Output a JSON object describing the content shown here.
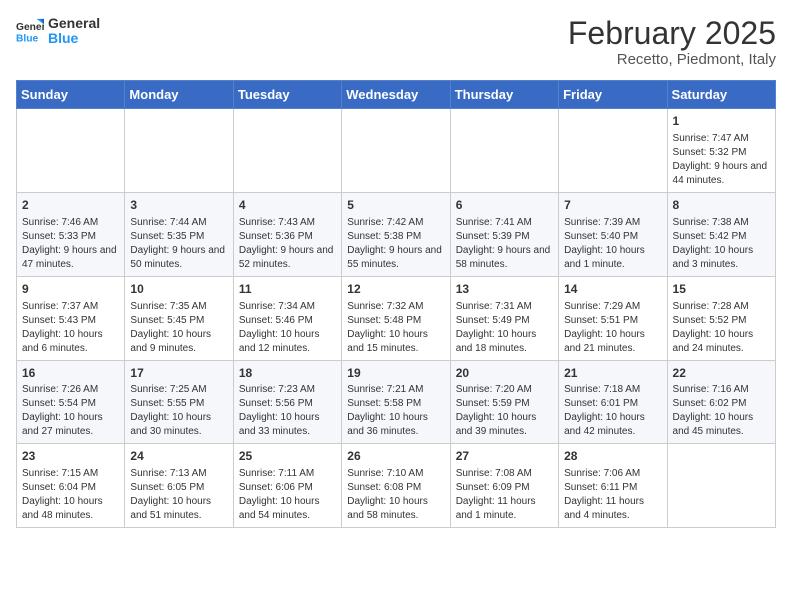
{
  "logo": {
    "line1": "General",
    "line2": "Blue"
  },
  "title": "February 2025",
  "subtitle": "Recetto, Piedmont, Italy",
  "headers": [
    "Sunday",
    "Monday",
    "Tuesday",
    "Wednesday",
    "Thursday",
    "Friday",
    "Saturday"
  ],
  "weeks": [
    [
      {
        "day": "",
        "info": ""
      },
      {
        "day": "",
        "info": ""
      },
      {
        "day": "",
        "info": ""
      },
      {
        "day": "",
        "info": ""
      },
      {
        "day": "",
        "info": ""
      },
      {
        "day": "",
        "info": ""
      },
      {
        "day": "1",
        "info": "Sunrise: 7:47 AM\nSunset: 5:32 PM\nDaylight: 9 hours and 44 minutes."
      }
    ],
    [
      {
        "day": "2",
        "info": "Sunrise: 7:46 AM\nSunset: 5:33 PM\nDaylight: 9 hours and 47 minutes."
      },
      {
        "day": "3",
        "info": "Sunrise: 7:44 AM\nSunset: 5:35 PM\nDaylight: 9 hours and 50 minutes."
      },
      {
        "day": "4",
        "info": "Sunrise: 7:43 AM\nSunset: 5:36 PM\nDaylight: 9 hours and 52 minutes."
      },
      {
        "day": "5",
        "info": "Sunrise: 7:42 AM\nSunset: 5:38 PM\nDaylight: 9 hours and 55 minutes."
      },
      {
        "day": "6",
        "info": "Sunrise: 7:41 AM\nSunset: 5:39 PM\nDaylight: 9 hours and 58 minutes."
      },
      {
        "day": "7",
        "info": "Sunrise: 7:39 AM\nSunset: 5:40 PM\nDaylight: 10 hours and 1 minute."
      },
      {
        "day": "8",
        "info": "Sunrise: 7:38 AM\nSunset: 5:42 PM\nDaylight: 10 hours and 3 minutes."
      }
    ],
    [
      {
        "day": "9",
        "info": "Sunrise: 7:37 AM\nSunset: 5:43 PM\nDaylight: 10 hours and 6 minutes."
      },
      {
        "day": "10",
        "info": "Sunrise: 7:35 AM\nSunset: 5:45 PM\nDaylight: 10 hours and 9 minutes."
      },
      {
        "day": "11",
        "info": "Sunrise: 7:34 AM\nSunset: 5:46 PM\nDaylight: 10 hours and 12 minutes."
      },
      {
        "day": "12",
        "info": "Sunrise: 7:32 AM\nSunset: 5:48 PM\nDaylight: 10 hours and 15 minutes."
      },
      {
        "day": "13",
        "info": "Sunrise: 7:31 AM\nSunset: 5:49 PM\nDaylight: 10 hours and 18 minutes."
      },
      {
        "day": "14",
        "info": "Sunrise: 7:29 AM\nSunset: 5:51 PM\nDaylight: 10 hours and 21 minutes."
      },
      {
        "day": "15",
        "info": "Sunrise: 7:28 AM\nSunset: 5:52 PM\nDaylight: 10 hours and 24 minutes."
      }
    ],
    [
      {
        "day": "16",
        "info": "Sunrise: 7:26 AM\nSunset: 5:54 PM\nDaylight: 10 hours and 27 minutes."
      },
      {
        "day": "17",
        "info": "Sunrise: 7:25 AM\nSunset: 5:55 PM\nDaylight: 10 hours and 30 minutes."
      },
      {
        "day": "18",
        "info": "Sunrise: 7:23 AM\nSunset: 5:56 PM\nDaylight: 10 hours and 33 minutes."
      },
      {
        "day": "19",
        "info": "Sunrise: 7:21 AM\nSunset: 5:58 PM\nDaylight: 10 hours and 36 minutes."
      },
      {
        "day": "20",
        "info": "Sunrise: 7:20 AM\nSunset: 5:59 PM\nDaylight: 10 hours and 39 minutes."
      },
      {
        "day": "21",
        "info": "Sunrise: 7:18 AM\nSunset: 6:01 PM\nDaylight: 10 hours and 42 minutes."
      },
      {
        "day": "22",
        "info": "Sunrise: 7:16 AM\nSunset: 6:02 PM\nDaylight: 10 hours and 45 minutes."
      }
    ],
    [
      {
        "day": "23",
        "info": "Sunrise: 7:15 AM\nSunset: 6:04 PM\nDaylight: 10 hours and 48 minutes."
      },
      {
        "day": "24",
        "info": "Sunrise: 7:13 AM\nSunset: 6:05 PM\nDaylight: 10 hours and 51 minutes."
      },
      {
        "day": "25",
        "info": "Sunrise: 7:11 AM\nSunset: 6:06 PM\nDaylight: 10 hours and 54 minutes."
      },
      {
        "day": "26",
        "info": "Sunrise: 7:10 AM\nSunset: 6:08 PM\nDaylight: 10 hours and 58 minutes."
      },
      {
        "day": "27",
        "info": "Sunrise: 7:08 AM\nSunset: 6:09 PM\nDaylight: 11 hours and 1 minute."
      },
      {
        "day": "28",
        "info": "Sunrise: 7:06 AM\nSunset: 6:11 PM\nDaylight: 11 hours and 4 minutes."
      },
      {
        "day": "",
        "info": ""
      }
    ]
  ]
}
